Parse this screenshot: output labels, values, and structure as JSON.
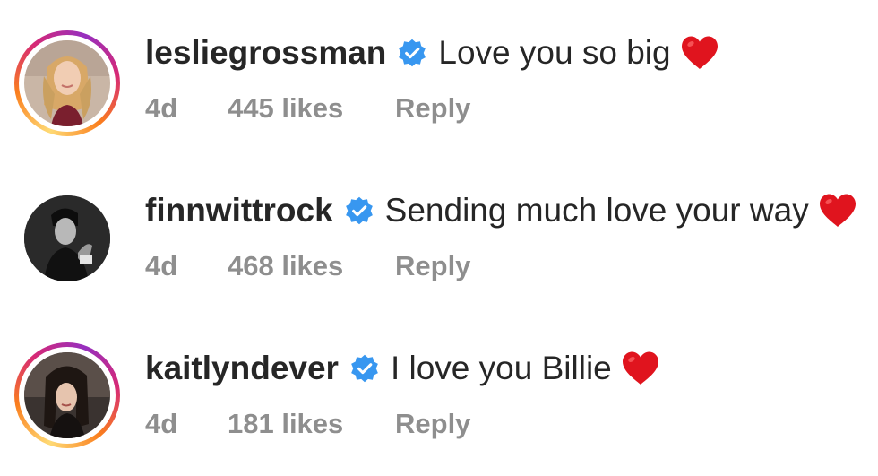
{
  "comments": [
    {
      "username": "lesliegrossman",
      "verified": true,
      "text": "Love you so big",
      "emoji": "heart-icon",
      "time": "4d",
      "likes": "445 likes",
      "reply_label": "Reply",
      "avatar_ring": true
    },
    {
      "username": "finnwittrock",
      "verified": true,
      "text": "Sending much love your way",
      "emoji": "heart-icon",
      "time": "4d",
      "likes": "468 likes",
      "reply_label": "Reply",
      "avatar_ring": false
    },
    {
      "username": "kaitlyndever",
      "verified": true,
      "text": "I love you Billie",
      "emoji": "heart-icon",
      "time": "4d",
      "likes": "181 likes",
      "reply_label": "Reply",
      "avatar_ring": true
    }
  ],
  "colors": {
    "verified_badge": "#3897f0",
    "heart": "#e0141e",
    "meta_text": "#8e8e8e",
    "primary_text": "#262626"
  }
}
